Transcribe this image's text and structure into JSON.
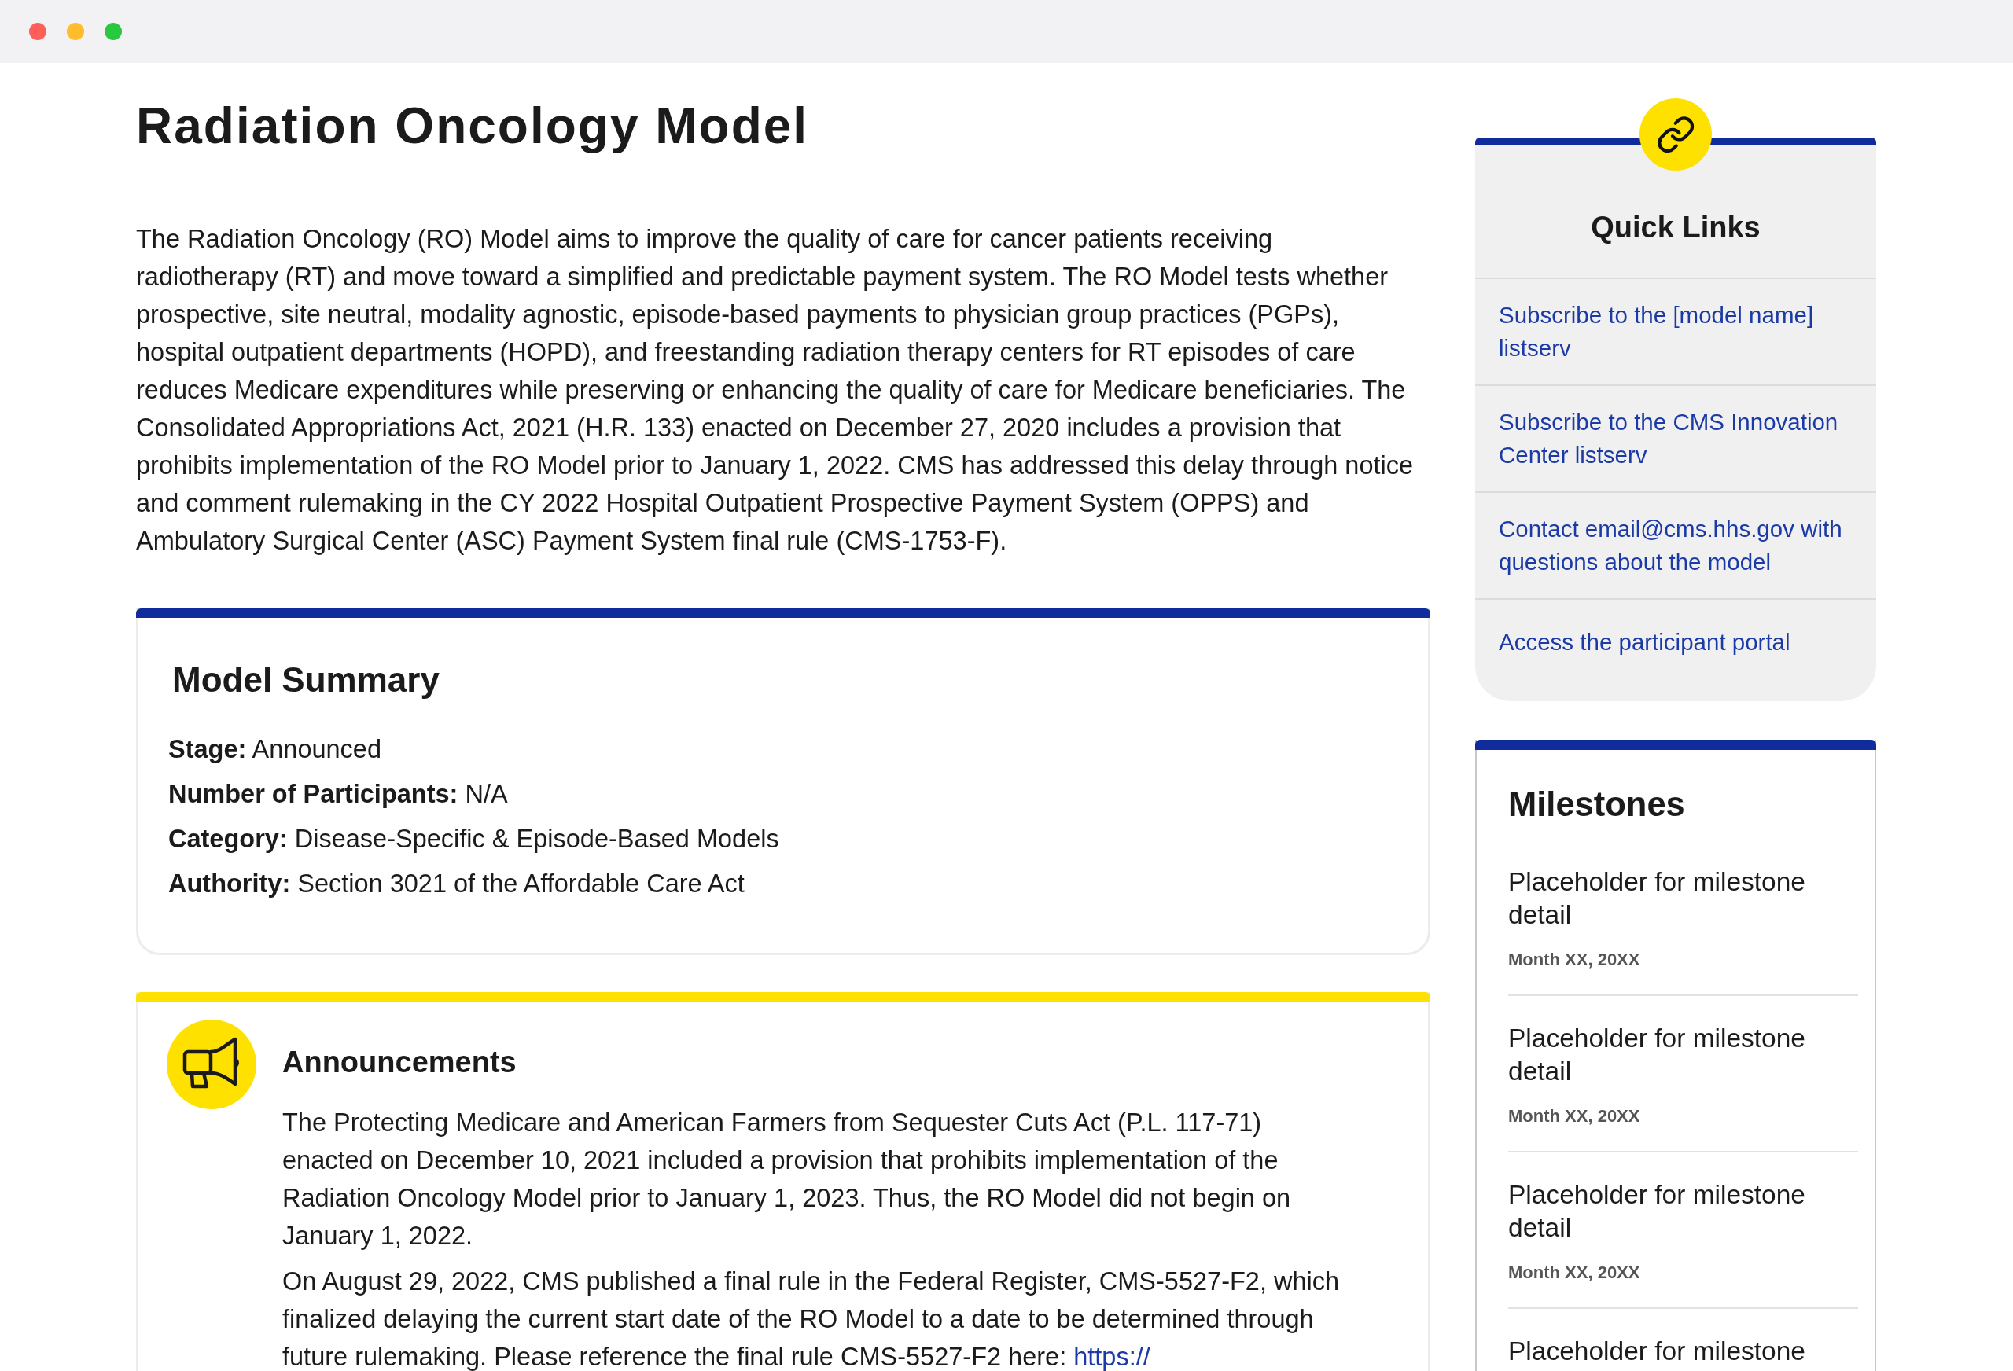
{
  "page": {
    "title": "Radiation Oncology Model",
    "intro": "The Radiation Oncology (RO) Model aims to improve the quality of care for cancer patients receiving radiotherapy (RT) and move toward a simplified and predictable payment system. The RO Model tests whether prospective, site neutral, modality agnostic, episode-based payments to physician group practices (PGPs), hospital outpatient departments (HOPD), and freestanding radiation therapy centers for RT episodes of care reduces Medicare expenditures while preserving or enhancing the quality of care for Medicare beneficiaries. The Consolidated Appropriations Act, 2021 (H.R. 133) enacted on December 27, 2020 includes a provision that prohibits implementation of the RO Model prior to January 1, 2022. CMS has addressed this delay through notice and comment rulemaking in the CY 2022 Hospital Outpatient Prospective Payment System (OPPS) and Ambulatory Surgical Center (ASC) Payment System final rule (CMS-1753-F)."
  },
  "model_summary": {
    "heading": "Model Summary",
    "facts": [
      "**Stage:** Announced",
      "**Number of Participants:** N/A",
      "**Category:** Disease-Specific & Episode-Based Models",
      "**Authority:** Section 3021 of the Affordable Care Act"
    ]
  },
  "announcements": {
    "heading": "Announcements",
    "paragraphs": [
      {
        "text": "The Protecting Medicare and American Farmers from Sequester Cuts Act (P.L. 117-71) enacted on December 10, 2021 included a provision that prohibits implementation of the Radiation Oncology Model prior to January 1, 2023. Thus, the RO Model did not begin on January 1, 2022."
      },
      {
        "text": "On August 29, 2022, CMS published a final rule in the Federal Register, CMS-5527-F2, which finalized delaying the current start date of the RO Model to a date to be determined through future rulemaking. Please reference the final rule CMS-5527-F2 here: ",
        "link": "https://"
      }
    ]
  },
  "quick_links": {
    "heading": "Quick Links",
    "links": [
      "Subscribe to the [model name] listserv",
      "Subscribe to the CMS Innovation Center listserv",
      "Contact email@cms.hhs.gov with questions about the model",
      "Access the participant portal"
    ]
  },
  "milestones": {
    "heading": "Milestones",
    "items": [
      {
        "detail": "Placeholder for milestone detail",
        "date": "Month XX, 20XX"
      },
      {
        "detail": "Placeholder for milestone detail",
        "date": "Month XX, 20XX"
      },
      {
        "detail": "Placeholder for milestone detail",
        "date": "Month XX, 20XX"
      },
      {
        "detail": "Placeholder for milestone"
      }
    ]
  }
}
